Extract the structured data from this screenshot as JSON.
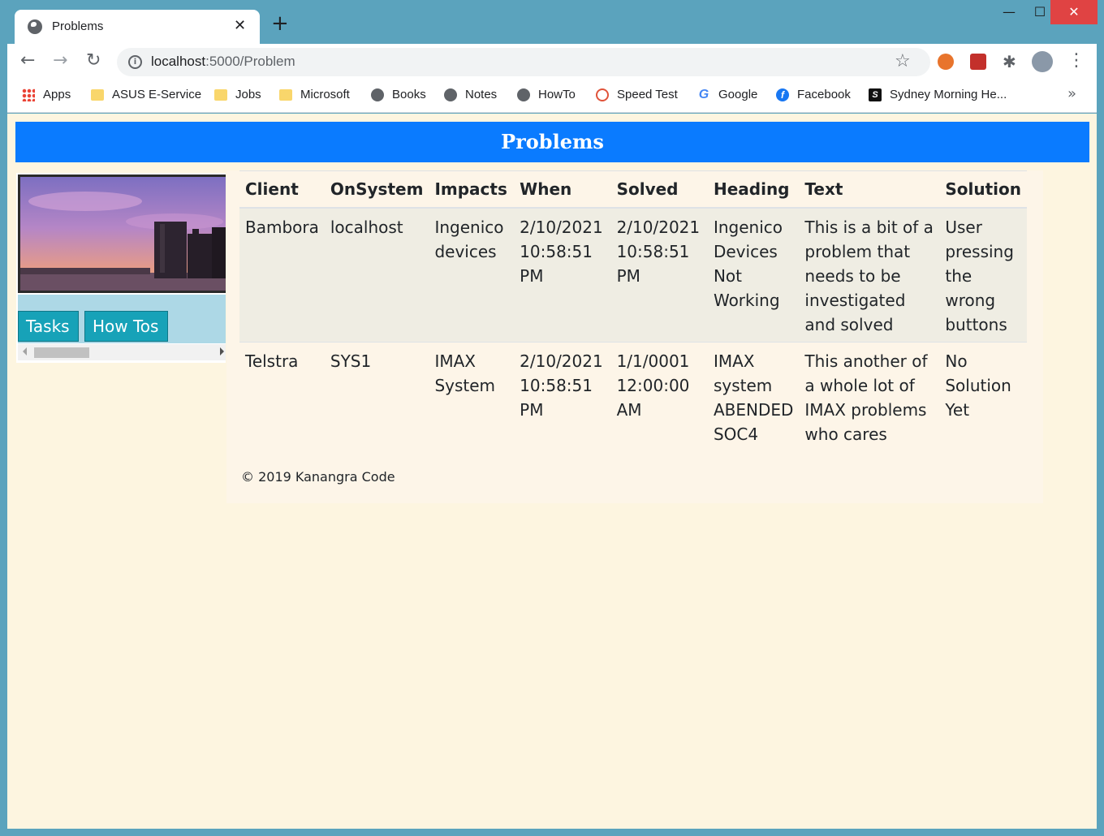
{
  "browser": {
    "tab_title": "Problems",
    "tab_close": "✕",
    "new_tab": "+",
    "window_min": "—",
    "window_max": "☐",
    "window_close": "✕",
    "nav_back": "←",
    "nav_forward": "→",
    "nav_reload": "↻",
    "url_host": "localhost",
    "url_path": ":5000/Problem",
    "star": "☆",
    "menu": "⋮",
    "bookmarks_more": "»",
    "bookmarks": [
      {
        "label": "Apps",
        "icon": "apps-icon"
      },
      {
        "label": "ASUS E-Service",
        "icon": "folder-icon"
      },
      {
        "label": "Jobs",
        "icon": "folder-icon"
      },
      {
        "label": "Microsoft",
        "icon": "folder-icon"
      },
      {
        "label": "Books",
        "icon": "globe-icon"
      },
      {
        "label": "Notes",
        "icon": "globe-icon"
      },
      {
        "label": "HowTo",
        "icon": "globe-icon"
      },
      {
        "label": "Speed Test",
        "icon": "speedometer-icon"
      },
      {
        "label": "Google",
        "icon": "google-icon"
      },
      {
        "label": "Facebook",
        "icon": "facebook-icon"
      },
      {
        "label": "Sydney Morning He...",
        "icon": "smh-icon"
      }
    ]
  },
  "page": {
    "banner_title": "Problems",
    "sidebar": {
      "nav": [
        {
          "label": "Tasks"
        },
        {
          "label": "How Tos"
        }
      ]
    },
    "table": {
      "headers": [
        "Client",
        "OnSystem",
        "Impacts",
        "When",
        "Solved",
        "Heading",
        "Text",
        "Solution"
      ],
      "rows": [
        [
          "Bambora",
          "localhost",
          "Ingenico devices",
          "2/10/2021 10:58:51 PM",
          "2/10/2021 10:58:51 PM",
          "Ingenico Devices Not Working",
          "This is a bit of a problem that needs to be investigated and solved",
          "User pressing the wrong buttons"
        ],
        [
          "Telstra",
          "SYS1",
          "IMAX System",
          "2/10/2021 10:58:51 PM",
          "1/1/0001 12:00:00 AM",
          "IMAX system ABENDED SOC4",
          "This another of a whole lot of IMAX problems who cares",
          "No Solution Yet"
        ]
      ]
    },
    "footer": "© 2019 Kanangra Code"
  },
  "colors": {
    "banner": "#0a7bff",
    "page_bg": "#fdf5e0",
    "nav_button": "#17a2b8",
    "sidebar_nav_bg": "#add8e6",
    "window_frame": "#5ba3bd"
  }
}
